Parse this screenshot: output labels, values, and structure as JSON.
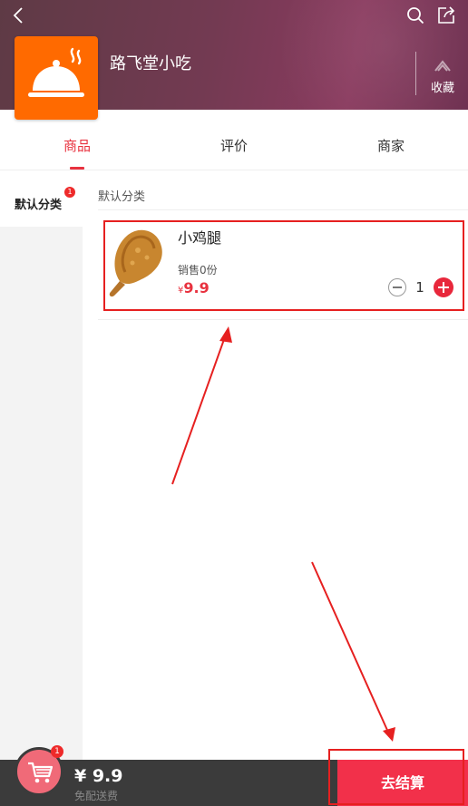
{
  "header": {
    "shop_name": "路飞堂小吃",
    "favorite_label": "收藏"
  },
  "tabs": [
    {
      "label": "商品",
      "active": true
    },
    {
      "label": "评价",
      "active": false
    },
    {
      "label": "商家",
      "active": false
    }
  ],
  "sidebar": {
    "items": [
      {
        "label": "默认分类",
        "badge": "1",
        "active": true
      }
    ]
  },
  "content": {
    "category_title": "默认分类",
    "products": [
      {
        "name": "小鸡腿",
        "sales": "销售0份",
        "currency": "¥",
        "price": "9.9",
        "quantity": "1"
      }
    ]
  },
  "cart": {
    "badge": "1",
    "total": "¥ 9.9",
    "delivery_note": "免配送费",
    "checkout_label": "去结算"
  },
  "colors": {
    "accent": "#e8323f",
    "checkout": "#f2304a",
    "logo": "#ff6a00",
    "bottom_bar": "#3b3b3b",
    "annotation": "#e62020"
  },
  "icons": [
    "back-icon",
    "search-icon",
    "share-icon",
    "favorite-icon",
    "cloche-icon",
    "cart-icon"
  ]
}
